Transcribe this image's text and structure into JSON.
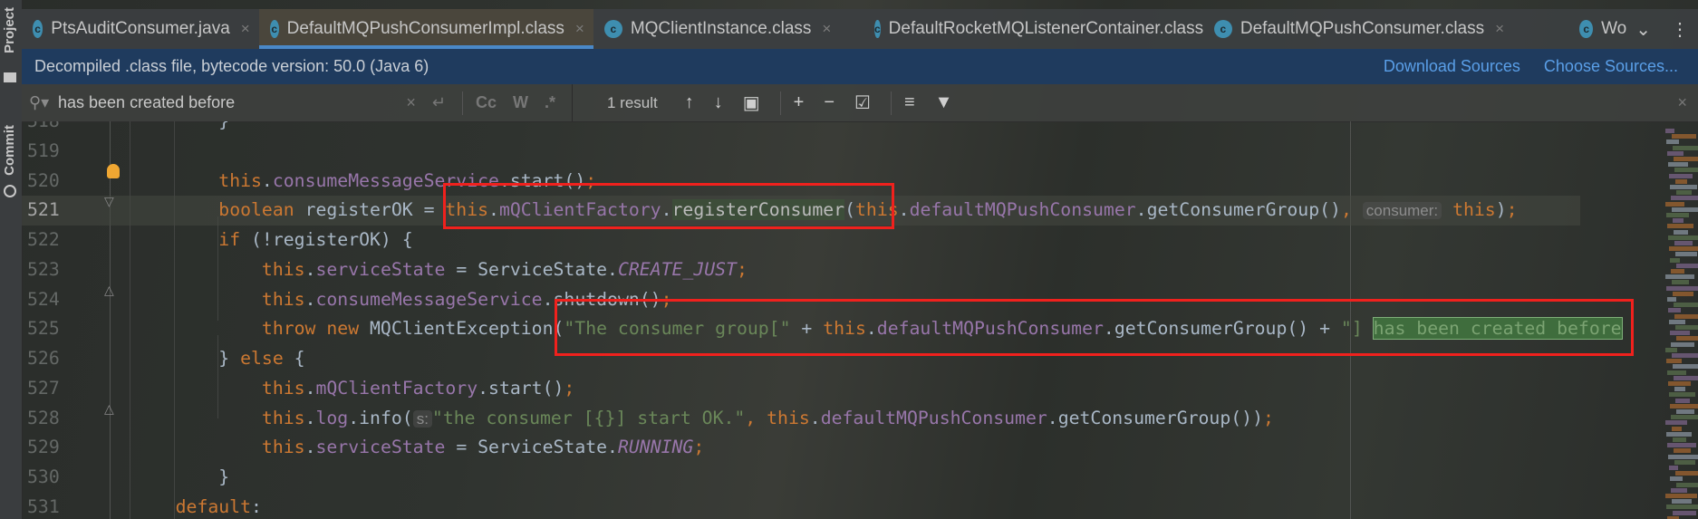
{
  "sidebar": {
    "project_label": "Project",
    "commit_label": "Commit"
  },
  "tabs": [
    {
      "label": "PtsAuditConsumer.java",
      "icon": "class-icon",
      "active": false
    },
    {
      "label": "DefaultMQPushConsumerImpl.class",
      "icon": "class-icon",
      "active": true
    },
    {
      "label": "MQClientInstance.class",
      "icon": "class-icon",
      "active": false
    },
    {
      "label": "DefaultRocketMQListenerContainer.class",
      "icon": "class-icon",
      "active": false
    },
    {
      "label": "DefaultMQPushConsumer.class",
      "icon": "class-icon",
      "active": false
    },
    {
      "label": "Wo",
      "icon": "class-icon",
      "active": false
    }
  ],
  "tab_icon_letter": "c",
  "infobar": {
    "message": "Decompiled .class file, bytecode version: 50.0 (Java 6)",
    "download_sources": "Download Sources",
    "choose_sources": "Choose Sources..."
  },
  "search": {
    "value": "has been created before",
    "result_count": "1 result",
    "match_case": "Cc",
    "words": "W",
    "regex": ".*"
  },
  "colors": {
    "keyword": "#cc7832",
    "field": "#9876aa",
    "string": "#6a8759",
    "plain": "#a9b7c6",
    "highlight_box": "#f0211d",
    "tab_underline": "#4a88c7",
    "infobar": "#1f3b5e"
  },
  "code": [
    {
      "num": "518",
      "tokens": [
        [
          "        }",
          "pl"
        ]
      ]
    },
    {
      "num": "519",
      "tokens": []
    },
    {
      "num": "520",
      "tokens": [
        [
          "        ",
          "pl"
        ],
        [
          "this",
          "kw"
        ],
        [
          ".",
          "pl"
        ],
        [
          "consumeMessageService",
          "fld"
        ],
        [
          ".start()",
          "pl"
        ],
        [
          ";",
          "kw"
        ]
      ]
    },
    {
      "num": "521",
      "caret": true,
      "tokens": [
        [
          "        ",
          "pl"
        ],
        [
          "boolean ",
          "kw"
        ],
        [
          "registerOK = ",
          "pl"
        ],
        [
          "this",
          "kw"
        ],
        [
          ".",
          "pl"
        ],
        [
          "mQClientFactory",
          "fld"
        ],
        [
          ".",
          "pl"
        ],
        [
          "registerConsumer",
          "mhl"
        ],
        [
          "(",
          "pl"
        ],
        [
          "this",
          "kw"
        ],
        [
          ".",
          "pl"
        ],
        [
          "defaultMQPushConsumer",
          "fld"
        ],
        [
          ".getConsumerGroup()",
          "pl"
        ],
        [
          ", ",
          "kw"
        ],
        [
          "consumer:",
          "hint"
        ],
        [
          " ",
          "pl"
        ],
        [
          "this",
          "kw"
        ],
        [
          ")",
          "pl"
        ],
        [
          ";",
          "kw"
        ]
      ]
    },
    {
      "num": "522",
      "tokens": [
        [
          "        ",
          "pl"
        ],
        [
          "if ",
          "kw"
        ],
        [
          "(!registerOK) {",
          "pl"
        ]
      ]
    },
    {
      "num": "523",
      "tokens": [
        [
          "            ",
          "pl"
        ],
        [
          "this",
          "kw"
        ],
        [
          ".",
          "pl"
        ],
        [
          "serviceState",
          "fld"
        ],
        [
          " = ServiceState.",
          "pl"
        ],
        [
          "CREATE_JUST",
          "const"
        ],
        [
          ";",
          "kw"
        ]
      ]
    },
    {
      "num": "524",
      "tokens": [
        [
          "            ",
          "pl"
        ],
        [
          "this",
          "kw"
        ],
        [
          ".",
          "pl"
        ],
        [
          "consumeMessageService",
          "fld"
        ],
        [
          ".shutdown()",
          "pl"
        ],
        [
          ";",
          "kw"
        ]
      ]
    },
    {
      "num": "525",
      "tokens": [
        [
          "            ",
          "pl"
        ],
        [
          "throw new ",
          "kw"
        ],
        [
          "MQClientException(",
          "pl"
        ],
        [
          "\"The consumer group[\"",
          "str"
        ],
        [
          " + ",
          "pl"
        ],
        [
          "this",
          "kw"
        ],
        [
          ".",
          "pl"
        ],
        [
          "defaultMQPushConsumer",
          "fld"
        ],
        [
          ".getConsumerGroup() + ",
          "pl"
        ],
        [
          "\"] ",
          "str"
        ],
        [
          "has been created before",
          "match"
        ]
      ]
    },
    {
      "num": "526",
      "tokens": [
        [
          "        ",
          "pl"
        ],
        [
          "} ",
          "pl"
        ],
        [
          "else ",
          "kw"
        ],
        [
          "{",
          "pl"
        ]
      ]
    },
    {
      "num": "527",
      "tokens": [
        [
          "            ",
          "pl"
        ],
        [
          "this",
          "kw"
        ],
        [
          ".",
          "pl"
        ],
        [
          "mQClientFactory",
          "fld"
        ],
        [
          ".start()",
          "pl"
        ],
        [
          ";",
          "kw"
        ]
      ]
    },
    {
      "num": "528",
      "tokens": [
        [
          "            ",
          "pl"
        ],
        [
          "this",
          "kw"
        ],
        [
          ".",
          "pl"
        ],
        [
          "log",
          "fld"
        ],
        [
          ".info(",
          "pl"
        ],
        [
          "s:",
          "hint"
        ],
        [
          "\"the consumer [{}] start OK.\"",
          "str"
        ],
        [
          ", ",
          "kw"
        ],
        [
          "this",
          "kw"
        ],
        [
          ".",
          "pl"
        ],
        [
          "defaultMQPushConsumer",
          "fld"
        ],
        [
          ".getConsumerGroup())",
          "pl"
        ],
        [
          ";",
          "kw"
        ]
      ]
    },
    {
      "num": "529",
      "tokens": [
        [
          "            ",
          "pl"
        ],
        [
          "this",
          "kw"
        ],
        [
          ".",
          "pl"
        ],
        [
          "serviceState",
          "fld"
        ],
        [
          " = ServiceState.",
          "pl"
        ],
        [
          "RUNNING",
          "const"
        ],
        [
          ";",
          "kw"
        ]
      ]
    },
    {
      "num": "530",
      "tokens": [
        [
          "        }",
          "pl"
        ]
      ]
    },
    {
      "num": "531",
      "tokens": [
        [
          "    ",
          "pl"
        ],
        [
          "default",
          "kw"
        ],
        [
          ":",
          "pl"
        ]
      ]
    }
  ]
}
